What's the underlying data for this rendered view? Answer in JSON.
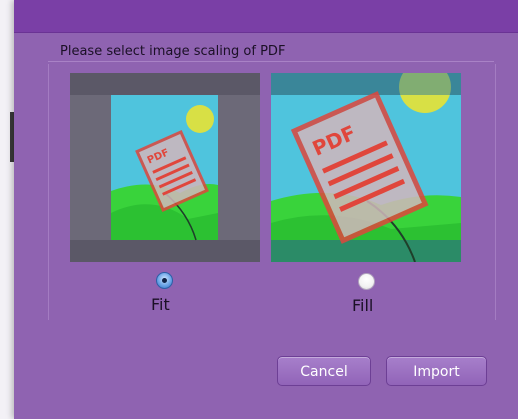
{
  "dialog": {
    "group_label": "Please select image scaling of PDF",
    "options": [
      {
        "label": "Fit",
        "selected": true
      },
      {
        "label": "Fill",
        "selected": false
      }
    ],
    "preview_badge": "PDF",
    "buttons": {
      "cancel": "Cancel",
      "import": "Import"
    }
  },
  "colors": {
    "dialog_bg": "#8f63b1",
    "title_bar": "#7a3fa6",
    "sky": "#4fc4dd",
    "hill": "#39d33b",
    "sun": "#d8e045",
    "pdf_red": "#e0463c",
    "radio_selected": "#6ba4e6"
  },
  "icons": {
    "radio_selected": "radio-selected-icon",
    "radio_unselected": "radio-unselected-icon"
  }
}
